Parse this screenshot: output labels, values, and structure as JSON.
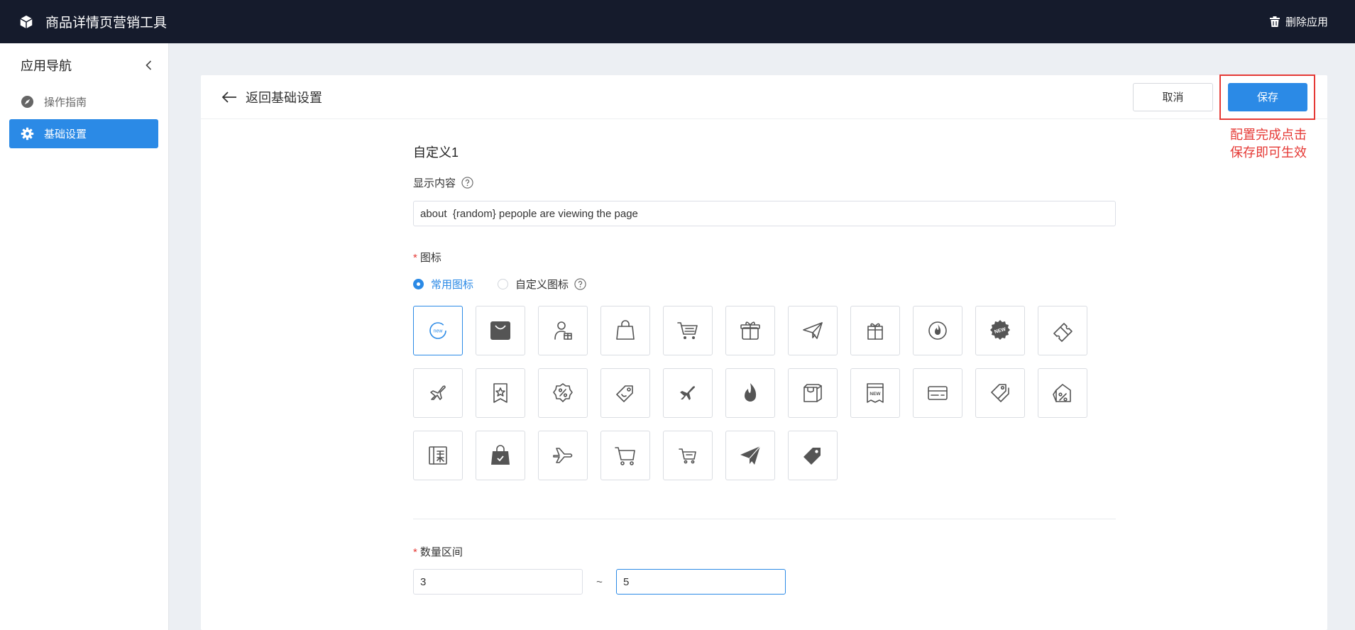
{
  "header": {
    "app_title": "商品详情页营销工具",
    "app_icon": "cube-icon",
    "delete_app_label": "删除应用"
  },
  "sidebar": {
    "title": "应用导航",
    "items": [
      {
        "label": "操作指南",
        "icon": "compass-icon",
        "active": false
      },
      {
        "label": "基础设置",
        "icon": "gear-icon",
        "active": true
      }
    ]
  },
  "page": {
    "back_label": "返回基础设置",
    "cancel_label": "取消",
    "save_label": "保存",
    "annotation_line1": "配置完成点击",
    "annotation_line2": "保存即可生效"
  },
  "form": {
    "section_title": "自定义1",
    "content_label": "显示内容",
    "content_value": "about  {random} pepople are viewing the page",
    "icon_label": "图标",
    "icon_source_options": [
      {
        "label": "常用图标",
        "checked": true
      },
      {
        "label": "自定义图标",
        "checked": false
      }
    ],
    "icons": [
      "new-badge-icon",
      "shopping-bag-filled-icon",
      "user-gift-icon",
      "shopping-bag-icon",
      "shopping-cart-icon",
      "gift-box-icon",
      "paper-plane-icon",
      "gift-icon",
      "fire-circle-icon",
      "new-seal-icon",
      "ticket-icon",
      "airplane-icon",
      "star-bookmark-icon",
      "discount-badge-icon",
      "price-tag-icon",
      "airplane-filled-icon",
      "flame-icon",
      "bags-icon",
      "new-label-icon",
      "card-icon",
      "tags-icon",
      "percent-tag-icon",
      "coupon-icon",
      "bag-check-filled-icon",
      "airplane-outline-icon",
      "cart-outline-icon",
      "cart-small-icon",
      "paper-plane-filled-icon",
      "tag-filled-icon"
    ],
    "selected_icon_index": 0,
    "range_label": "数量区间",
    "range_min": "3",
    "range_max": "5",
    "range_separator": "~"
  },
  "colors": {
    "topbar_bg": "#151b2c",
    "accent": "#2b8ae6",
    "annotation": "#e53935",
    "icon_fill": "#555555"
  }
}
